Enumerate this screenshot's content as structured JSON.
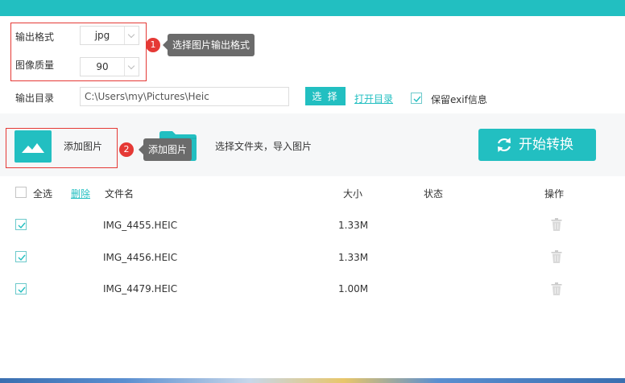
{
  "settings": {
    "format_label": "输出格式",
    "format_value": "jpg",
    "quality_label": "图像质量",
    "quality_value": "90",
    "output_dir_label": "输出目录",
    "output_dir_value": "C:\\Users\\my\\Pictures\\Heic",
    "choose_label": "选 择",
    "open_dir_label": "打开目录",
    "keep_exif_label": "保留exif信息",
    "keep_exif_checked": true
  },
  "annotations": [
    {
      "number": "1",
      "text": "选择图片输出格式"
    },
    {
      "number": "2",
      "text": "添加图片"
    }
  ],
  "actions": {
    "add_image_label": "添加图片",
    "select_folder_label": "选择文件夹，导入图片",
    "start_label": "开始转换"
  },
  "table": {
    "select_all_label": "全选",
    "delete_label": "删除",
    "columns": {
      "name": "文件名",
      "size": "大小",
      "status": "状态",
      "action": "操作"
    },
    "rows": [
      {
        "name": "IMG_4455.HEIC",
        "size": "1.33M",
        "status": "",
        "checked": true
      },
      {
        "name": "IMG_4456.HEIC",
        "size": "1.33M",
        "status": "",
        "checked": true
      },
      {
        "name": "IMG_4479.HEIC",
        "size": "1.00M",
        "status": "",
        "checked": true
      }
    ]
  },
  "colors": {
    "accent": "#22bfc1",
    "annotation": "#e53935",
    "tooltip": "#6b6b6b"
  },
  "icons": {
    "add_image": "image-icon",
    "folder": "folder-icon",
    "start": "refresh-icon",
    "row_action": "trash-icon"
  }
}
